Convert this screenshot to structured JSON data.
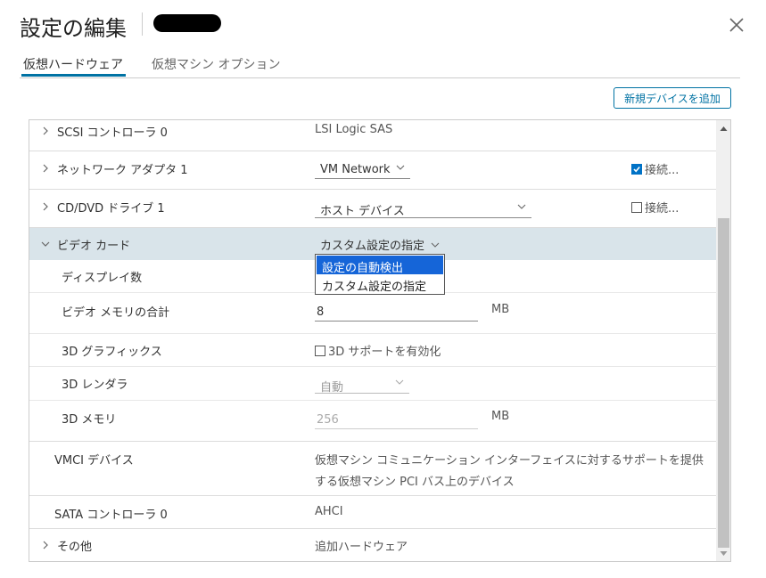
{
  "dialog": {
    "title": "設定の編集"
  },
  "tabs": [
    {
      "label": "仮想ハードウェア",
      "active": true
    },
    {
      "label": "仮想マシン オプション",
      "active": false
    }
  ],
  "toolbar": {
    "add_device_label": "新規デバイスを追加"
  },
  "hardware": {
    "scsi": {
      "label": "SCSI コントローラ 0",
      "value": "LSI Logic SAS"
    },
    "network": {
      "label": "ネットワーク アダプタ 1",
      "select_value": "VM Network",
      "connect_label": "接続...",
      "connected": true
    },
    "cddvd": {
      "label": "CD/DVD ドライブ 1",
      "select_value": "ホスト デバイス",
      "connect_label": "接続...",
      "connected": false
    },
    "video": {
      "label": "ビデオ カード",
      "select_value": "カスタム設定の指定",
      "dropdown_options": [
        "設定の自動検出",
        "カスタム設定の指定"
      ],
      "displays_label": "ディスプレイ数",
      "memory_label": "ビデオ メモリの合計",
      "memory_value": "8",
      "memory_unit": "MB",
      "graphics_label": "3D グラフィックス",
      "graphics_checkbox_label": "3D サポートを有効化",
      "graphics_enabled": false,
      "renderer_label": "3D レンダラ",
      "renderer_value": "自動",
      "mem3d_label": "3D メモリ",
      "mem3d_value": "256",
      "mem3d_unit": "MB"
    },
    "vmci": {
      "label": "VMCI デバイス",
      "value_line1": "仮想マシン コミュニケーション インターフェイスに対するサポートを提供",
      "value_line2": "する仮想マシン PCI バス上のデバイス"
    },
    "sata": {
      "label": "SATA コントローラ 0",
      "value": "AHCI"
    },
    "other": {
      "label": "その他",
      "value": "追加ハードウェア"
    }
  },
  "colors": {
    "accent": "#0072a3",
    "highlight_row": "#d9e4ea",
    "dropdown_selected": "#1565d8"
  }
}
